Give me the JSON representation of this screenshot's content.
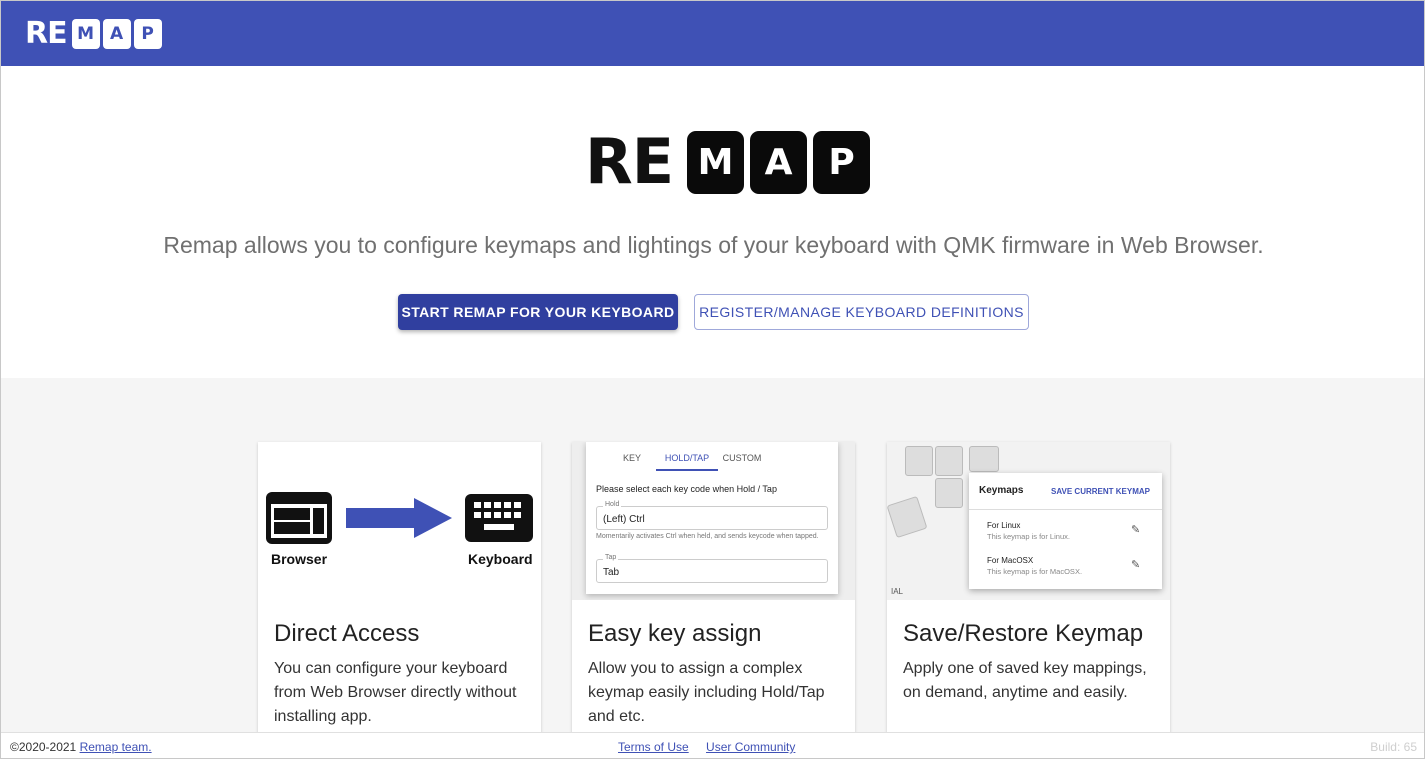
{
  "header": {
    "logo": {
      "text": "RE",
      "tiles": [
        "M",
        "A",
        "P"
      ]
    }
  },
  "hero": {
    "logo": {
      "text": "RE",
      "tiles": [
        "M",
        "A",
        "P"
      ]
    },
    "tagline": "Remap allows you to configure keymaps and lightings of your keyboard with QMK firmware in Web Browser.",
    "start_button": "START REMAP FOR YOUR KEYBOARD",
    "register_button": "REGISTER/MANAGE KEYBOARD DEFINITIONS"
  },
  "features": [
    {
      "title": "Direct Access",
      "description": "You can configure your keyboard from Web Browser directly without installing app.",
      "media": {
        "left_label": "Browser",
        "right_label": "Keyboard"
      }
    },
    {
      "title": "Easy key assign",
      "description": "Allow you to assign a complex keymap easily including Hold/Tap and etc.",
      "media": {
        "tabs": [
          "KEY",
          "HOLD/TAP",
          "CUSTOM"
        ],
        "hint": "Please select each key code when Hold / Tap",
        "hold_label": "Hold",
        "hold_value": "(Left) Ctrl",
        "hold_help": "Momentarily activates Ctrl when held, and sends keycode when tapped.",
        "tap_label": "Tap",
        "tap_value": "Tab"
      }
    },
    {
      "title": "Save/Restore Keymap",
      "description": "Apply one of saved key mappings, on demand, anytime and easily.",
      "media": {
        "panel_title": "Keymaps",
        "save_label": "SAVE CURRENT KEYMAP",
        "items": [
          {
            "name": "For Linux",
            "note": "This keymap is for Linux."
          },
          {
            "name": "For MacOSX",
            "note": "This keymap is for MacOSX."
          }
        ],
        "key_fragment": "IAL"
      }
    }
  ],
  "footer": {
    "copyright": "©2020-2021",
    "team_link": "Remap team.",
    "terms_link": "Terms of Use",
    "community_link": "User Community",
    "build": "Build: 65"
  },
  "colors": {
    "primary": "#3f51b5",
    "primary_dark": "#303f9f",
    "section_bg": "#f5f5f5"
  }
}
